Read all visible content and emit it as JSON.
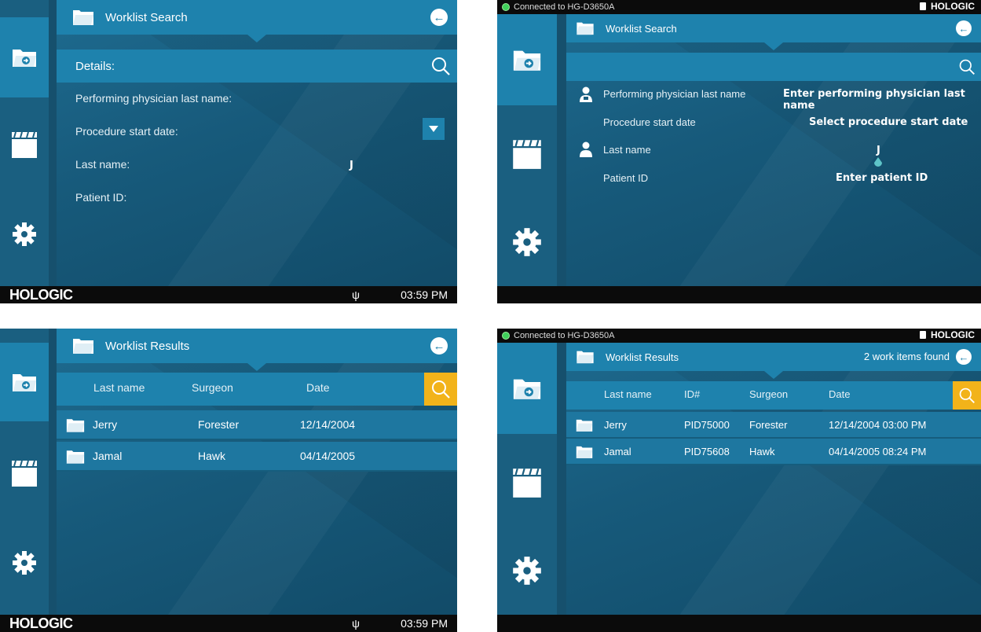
{
  "screen1": {
    "title": "Worklist Search",
    "details_label": "Details:",
    "fields": [
      {
        "label": "Performing physician last name:"
      },
      {
        "label": "Procedure start date:"
      },
      {
        "label": "Last name:",
        "value": "J"
      },
      {
        "label": "Patient ID:"
      }
    ],
    "logo": "HOLOGIC",
    "time": "03:59 PM"
  },
  "screen2": {
    "connection": "Connected to HG-D3650A",
    "logo": "HOLOGIC",
    "title": "Worklist Search",
    "fields": [
      {
        "label": "Performing physician last name",
        "value": "Enter performing physician last name"
      },
      {
        "label": "Procedure start date",
        "value": "Select procedure start date"
      },
      {
        "label": "Last name",
        "value": "J"
      },
      {
        "label": "Patient ID",
        "value": "Enter patient ID"
      }
    ]
  },
  "screen3": {
    "title": "Worklist Results",
    "columns": [
      "Last name",
      "Surgeon",
      "Date"
    ],
    "rows": [
      {
        "last_name": "Jerry",
        "surgeon": "Forester",
        "date": "12/14/2004"
      },
      {
        "last_name": "Jamal",
        "surgeon": "Hawk",
        "date": "04/14/2005"
      }
    ],
    "logo": "HOLOGIC",
    "time": "03:59 PM"
  },
  "screen4": {
    "connection": "Connected to HG-D3650A",
    "logo": "HOLOGIC",
    "title": "Worklist Results",
    "found": "2 work items found",
    "columns": [
      "Last name",
      "ID#",
      "Surgeon",
      "Date"
    ],
    "rows": [
      {
        "last_name": "Jerry",
        "id": "PID75000",
        "surgeon": "Forester",
        "date": "12/14/2004 03:00 PM"
      },
      {
        "last_name": "Jamal",
        "id": "PID75608",
        "surgeon": "Hawk",
        "date": "04/14/2005 08:24 PM"
      }
    ]
  },
  "colors": {
    "accent": "#1e82ad",
    "panel": "#175a7b",
    "search_active": "#f2b31a",
    "status_bar": "#0b0b0b",
    "connected": "#3fcf5a"
  },
  "icons": [
    "folder-worklist-icon",
    "clapper-folder-icon",
    "gear-icon",
    "back-arrow-icon",
    "search-icon",
    "dropdown-arrow-icon",
    "usb-icon",
    "person-icon",
    "physician-icon",
    "folder-icon"
  ]
}
